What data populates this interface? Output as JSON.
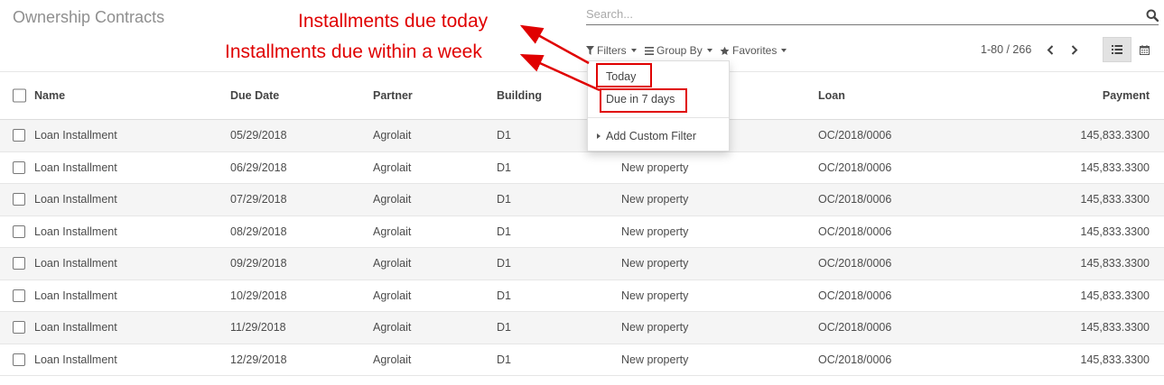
{
  "header": {
    "title": "Ownership Contracts",
    "search_placeholder": "Search...",
    "filters_label": "Filters",
    "group_by_label": "Group By",
    "favorites_label": "Favorites",
    "pager": "1-80 / 266"
  },
  "filter_menu": {
    "today": "Today",
    "due_7_days": "Due in 7 days",
    "add_custom": "Add Custom Filter"
  },
  "annotations": {
    "today": "Installments due today",
    "week": "Installments due within a week"
  },
  "table": {
    "columns": [
      "Name",
      "Due Date",
      "Partner",
      "Building",
      "Loan",
      "Payment"
    ],
    "rows": [
      {
        "name": "Loan Installment",
        "date": "05/29/2018",
        "partner": "Agrolait",
        "building": "D1",
        "property": "",
        "loan": "OC/2018/0006",
        "payment": "145,833.3300"
      },
      {
        "name": "Loan Installment",
        "date": "06/29/2018",
        "partner": "Agrolait",
        "building": "D1",
        "property": "New property",
        "loan": "OC/2018/0006",
        "payment": "145,833.3300"
      },
      {
        "name": "Loan Installment",
        "date": "07/29/2018",
        "partner": "Agrolait",
        "building": "D1",
        "property": "New property",
        "loan": "OC/2018/0006",
        "payment": "145,833.3300"
      },
      {
        "name": "Loan Installment",
        "date": "08/29/2018",
        "partner": "Agrolait",
        "building": "D1",
        "property": "New property",
        "loan": "OC/2018/0006",
        "payment": "145,833.3300"
      },
      {
        "name": "Loan Installment",
        "date": "09/29/2018",
        "partner": "Agrolait",
        "building": "D1",
        "property": "New property",
        "loan": "OC/2018/0006",
        "payment": "145,833.3300"
      },
      {
        "name": "Loan Installment",
        "date": "10/29/2018",
        "partner": "Agrolait",
        "building": "D1",
        "property": "New property",
        "loan": "OC/2018/0006",
        "payment": "145,833.3300"
      },
      {
        "name": "Loan Installment",
        "date": "11/29/2018",
        "partner": "Agrolait",
        "building": "D1",
        "property": "New property",
        "loan": "OC/2018/0006",
        "payment": "145,833.3300"
      },
      {
        "name": "Loan Installment",
        "date": "12/29/2018",
        "partner": "Agrolait",
        "building": "D1",
        "property": "New property",
        "loan": "OC/2018/0006",
        "payment": "145,833.3300"
      }
    ]
  },
  "colors": {
    "annotation": "#e00000",
    "active_view": "#e2e2e2"
  },
  "icons": [
    "search-icon",
    "filter-icon",
    "list-icon",
    "star-icon",
    "chevron-left-icon",
    "chevron-right-icon",
    "list-view-icon",
    "calendar-icon",
    "triangle-right-icon"
  ]
}
